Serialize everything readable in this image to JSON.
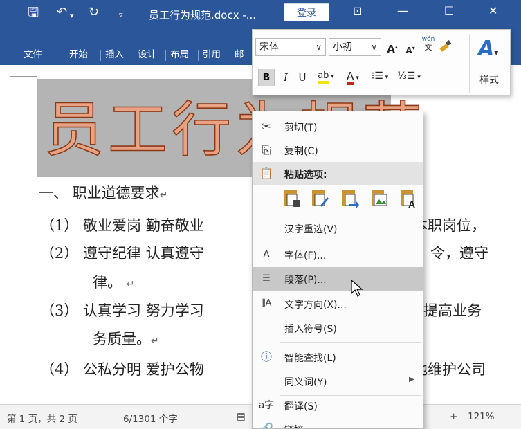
{
  "titlebar": {
    "save_icon": "save-icon",
    "undo_icon": "undo-icon",
    "redo_icon": "redo-icon",
    "qat_dropdown_icon": "chevron-down-icon",
    "doc_title": "员工行为规范.docx -...",
    "login_label": "登录",
    "ribbon_display_icon": "ribbon-display-icon",
    "minimize_glyph": "—",
    "maximize_glyph": "☐",
    "close_glyph": "✕",
    "bg_color": "#2b579a"
  },
  "tabs": [
    "文件",
    "开始",
    "插入",
    "设计",
    "布局",
    "引用",
    "邮"
  ],
  "mini_toolbar": {
    "font_name": "宋体",
    "font_size": "小初",
    "grow_font_label": "A",
    "shrink_font_label": "A",
    "phonetic_top": "wén",
    "phonetic_bottom": "文",
    "bold_label": "B",
    "italic_label": "I",
    "underline_label": "U",
    "highlight_label": "ab",
    "font_color_label": "A",
    "styles_label": "样式"
  },
  "document": {
    "title_text": "员工行为规范",
    "heading1": "一、  职业道德要求",
    "item1": "（1） 敬业爱岗  勤奋敬业",
    "item1_right": "本职岗位，",
    "item2": "（2） 遵守纪律  认真遵守",
    "item2_right": "令，遵守",
    "item2_cont": "律。",
    "item3": "（3） 认真学习  努力学习",
    "item3_right": "提高业务",
    "item3_cont": "务质量。",
    "item4": "（4） 公私分明  爱护公物",
    "item4_right": "地维护公司",
    "para_mark": "↵",
    "title_fill_color": "#e9a384",
    "title_stroke_color": "#8b3a18"
  },
  "context_menu": {
    "cut": "剪切(T)",
    "copy": "复制(C)",
    "paste_options": "粘贴选项:",
    "reconvert": "汉字重选(V)",
    "font": "字体(F)...",
    "paragraph": "段落(P)...",
    "text_direction": "文字方向(X)...",
    "insert_symbol": "插入符号(S)",
    "smart_lookup": "智能查找(L)",
    "synonyms": "同义词(Y)",
    "translate": "翻译(S)",
    "link": "链接..."
  },
  "statusbar": {
    "page": "第 1 页，共 2 页",
    "words": "6/1301 个字",
    "zoom_minus": "—",
    "zoom_plus": "+",
    "zoom": "121%"
  }
}
